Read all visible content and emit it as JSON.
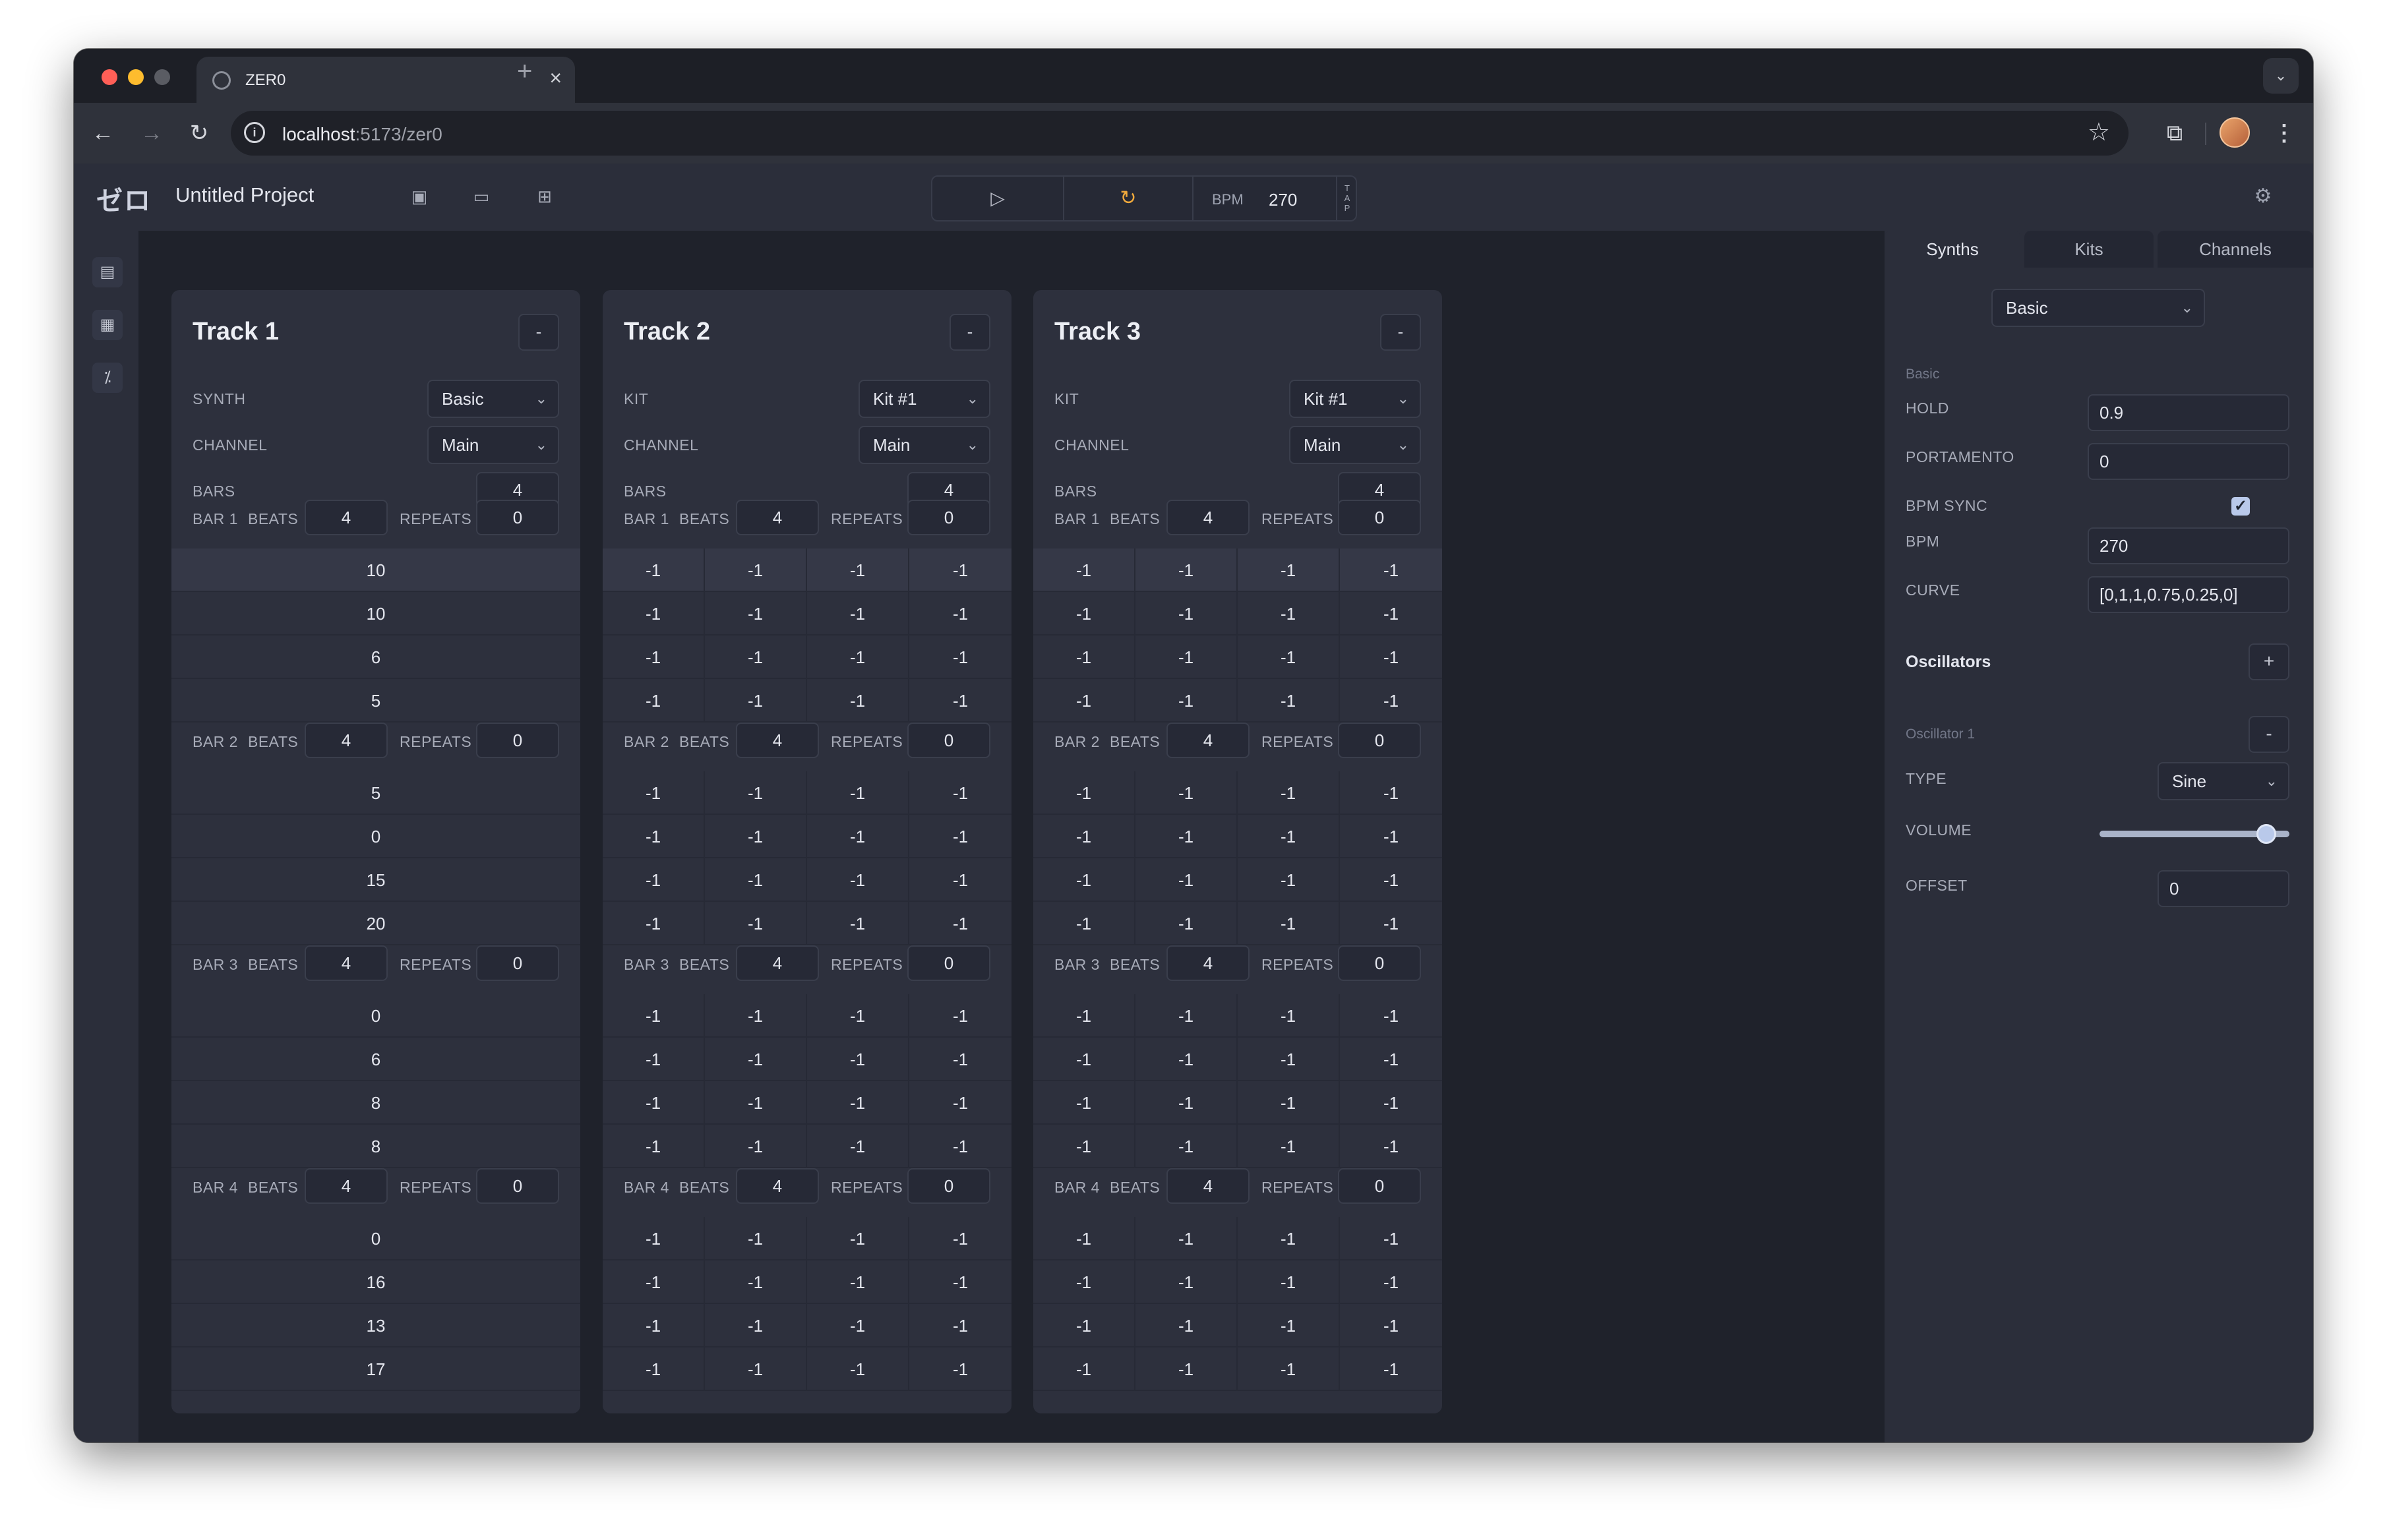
{
  "browser": {
    "tab_title": "ZER0",
    "tab_close": "×",
    "new_tab": "+",
    "url_host": "localhost",
    "url_path": ":5173/zer0"
  },
  "app": {
    "logo": "ゼロ",
    "project_title": "Untitled Project",
    "bpm_label": "BPM",
    "bpm_value": "270",
    "tap_label": "TAP"
  },
  "tracks": [
    {
      "title": "Track 1",
      "remove": "-",
      "source_label": "SYNTH",
      "source_value": "Basic",
      "channel_label": "CHANNEL",
      "channel_value": "Main",
      "bars_label": "BARS",
      "bars_value": "4",
      "bars": [
        {
          "label": "BAR 1",
          "beats_label": "BEATS",
          "beats": "4",
          "repeats_label": "REPEATS",
          "repeats": "0",
          "steps": [
            [
              "10"
            ],
            [
              "10"
            ],
            [
              "6"
            ],
            [
              "5"
            ]
          ]
        },
        {
          "label": "BAR 2",
          "beats_label": "BEATS",
          "beats": "4",
          "repeats_label": "REPEATS",
          "repeats": "0",
          "steps": [
            [
              "5"
            ],
            [
              "0"
            ],
            [
              "15"
            ],
            [
              "20"
            ]
          ]
        },
        {
          "label": "BAR 3",
          "beats_label": "BEATS",
          "beats": "4",
          "repeats_label": "REPEATS",
          "repeats": "0",
          "steps": [
            [
              "0"
            ],
            [
              "6"
            ],
            [
              "8"
            ],
            [
              "8"
            ]
          ]
        },
        {
          "label": "BAR 4",
          "beats_label": "BEATS",
          "beats": "4",
          "repeats_label": "REPEATS",
          "repeats": "0",
          "steps": [
            [
              "0"
            ],
            [
              "16"
            ],
            [
              "13"
            ],
            [
              "17"
            ]
          ]
        }
      ]
    },
    {
      "title": "Track 2",
      "remove": "-",
      "source_label": "KIT",
      "source_value": "Kit #1",
      "channel_label": "CHANNEL",
      "channel_value": "Main",
      "bars_label": "BARS",
      "bars_value": "4",
      "bars": [
        {
          "label": "BAR 1",
          "beats_label": "BEATS",
          "beats": "4",
          "repeats_label": "REPEATS",
          "repeats": "0",
          "steps": [
            [
              "-1",
              "-1",
              "-1",
              "-1"
            ],
            [
              "-1",
              "-1",
              "-1",
              "-1"
            ],
            [
              "-1",
              "-1",
              "-1",
              "-1"
            ],
            [
              "-1",
              "-1",
              "-1",
              "-1"
            ]
          ]
        },
        {
          "label": "BAR 2",
          "beats_label": "BEATS",
          "beats": "4",
          "repeats_label": "REPEATS",
          "repeats": "0",
          "steps": [
            [
              "-1",
              "-1",
              "-1",
              "-1"
            ],
            [
              "-1",
              "-1",
              "-1",
              "-1"
            ],
            [
              "-1",
              "-1",
              "-1",
              "-1"
            ],
            [
              "-1",
              "-1",
              "-1",
              "-1"
            ]
          ]
        },
        {
          "label": "BAR 3",
          "beats_label": "BEATS",
          "beats": "4",
          "repeats_label": "REPEATS",
          "repeats": "0",
          "steps": [
            [
              "-1",
              "-1",
              "-1",
              "-1"
            ],
            [
              "-1",
              "-1",
              "-1",
              "-1"
            ],
            [
              "-1",
              "-1",
              "-1",
              "-1"
            ],
            [
              "-1",
              "-1",
              "-1",
              "-1"
            ]
          ]
        },
        {
          "label": "BAR 4",
          "beats_label": "BEATS",
          "beats": "4",
          "repeats_label": "REPEATS",
          "repeats": "0",
          "steps": [
            [
              "-1",
              "-1",
              "-1",
              "-1"
            ],
            [
              "-1",
              "-1",
              "-1",
              "-1"
            ],
            [
              "-1",
              "-1",
              "-1",
              "-1"
            ],
            [
              "-1",
              "-1",
              "-1",
              "-1"
            ]
          ]
        }
      ]
    },
    {
      "title": "Track 3",
      "remove": "-",
      "source_label": "KIT",
      "source_value": "Kit #1",
      "channel_label": "CHANNEL",
      "channel_value": "Main",
      "bars_label": "BARS",
      "bars_value": "4",
      "bars": [
        {
          "label": "BAR 1",
          "beats_label": "BEATS",
          "beats": "4",
          "repeats_label": "REPEATS",
          "repeats": "0",
          "steps": [
            [
              "-1",
              "-1",
              "-1",
              "-1"
            ],
            [
              "-1",
              "-1",
              "-1",
              "-1"
            ],
            [
              "-1",
              "-1",
              "-1",
              "-1"
            ],
            [
              "-1",
              "-1",
              "-1",
              "-1"
            ]
          ]
        },
        {
          "label": "BAR 2",
          "beats_label": "BEATS",
          "beats": "4",
          "repeats_label": "REPEATS",
          "repeats": "0",
          "steps": [
            [
              "-1",
              "-1",
              "-1",
              "-1"
            ],
            [
              "-1",
              "-1",
              "-1",
              "-1"
            ],
            [
              "-1",
              "-1",
              "-1",
              "-1"
            ],
            [
              "-1",
              "-1",
              "-1",
              "-1"
            ]
          ]
        },
        {
          "label": "BAR 3",
          "beats_label": "BEATS",
          "beats": "4",
          "repeats_label": "REPEATS",
          "repeats": "0",
          "steps": [
            [
              "-1",
              "-1",
              "-1",
              "-1"
            ],
            [
              "-1",
              "-1",
              "-1",
              "-1"
            ],
            [
              "-1",
              "-1",
              "-1",
              "-1"
            ],
            [
              "-1",
              "-1",
              "-1",
              "-1"
            ]
          ]
        },
        {
          "label": "BAR 4",
          "beats_label": "BEATS",
          "beats": "4",
          "repeats_label": "REPEATS",
          "repeats": "0",
          "steps": [
            [
              "-1",
              "-1",
              "-1",
              "-1"
            ],
            [
              "-1",
              "-1",
              "-1",
              "-1"
            ],
            [
              "-1",
              "-1",
              "-1",
              "-1"
            ],
            [
              "-1",
              "-1",
              "-1",
              "-1"
            ]
          ]
        }
      ]
    }
  ],
  "panel": {
    "tabs": [
      "Synths",
      "Kits",
      "Channels"
    ],
    "active_tab": "Synths",
    "synth_select": "Basic",
    "section_title": "Basic",
    "hold_label": "HOLD",
    "hold_value": "0.9",
    "portamento_label": "PORTAMENTO",
    "portamento_value": "0",
    "bpm_sync_label": "BPM SYNC",
    "bpm_sync_checked": true,
    "bpm_label": "BPM",
    "bpm_value": "270",
    "curve_label": "CURVE",
    "curve_value": "[0,1,1,0.75,0.25,0]",
    "oscillators_heading": "Oscillators",
    "add_oscillator": "+",
    "oscillator_title": "Oscillator 1",
    "remove_oscillator": "-",
    "type_label": "TYPE",
    "type_value": "Sine",
    "volume_label": "VOLUME",
    "volume_level": 0.88,
    "offset_label": "OFFSET",
    "offset_value": "0"
  },
  "colors": {
    "background": "#1f222b",
    "panel": "#2b2e3a",
    "track_card": "#2d303d",
    "accent_loop": "#f0a93c",
    "checkbox": "#b9c9ea"
  },
  "icons": {
    "play": "play-icon",
    "loop": "loop-icon",
    "save": "save-icon",
    "open": "folder-icon",
    "add": "add-track-icon",
    "settings": "gear-icon"
  }
}
